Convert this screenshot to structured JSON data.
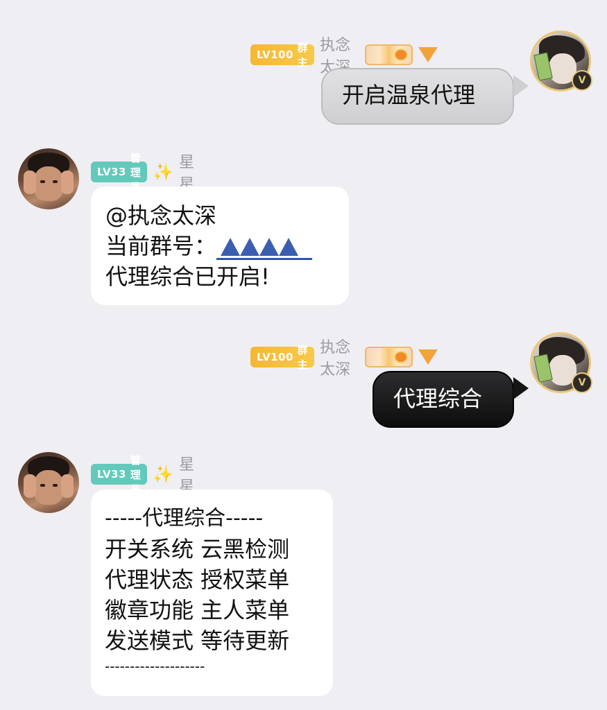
{
  "messages": [
    {
      "side": "right",
      "level": "LV100",
      "role": "群主",
      "name": "执念太深",
      "text": "开启温泉代理",
      "style": "grey"
    },
    {
      "side": "left",
      "level": "LV33",
      "role": "管理员",
      "sparkle": "✨",
      "name": "星星",
      "lines": [
        "@执念太深",
        "当前群号：",
        "代理综合已开启!"
      ],
      "style": "white"
    },
    {
      "side": "right",
      "level": "LV100",
      "role": "群主",
      "name": "执念太深",
      "text": "代理综合",
      "style": "black"
    },
    {
      "side": "left",
      "level": "LV33",
      "role": "管理员",
      "sparkle": "✨",
      "name": "星星",
      "lines": [
        "-----代理综合-----",
        "开关系统 云黑检测",
        "代理状态 授权菜单",
        "徽章功能 主人菜单",
        "发送模式 等待更新",
        "--------------------"
      ],
      "style": "white"
    }
  ],
  "badges": {
    "vip": "V"
  },
  "colors": {
    "background": "#efeef3",
    "gold_badge": "#f6b733",
    "teal_badge": "#63c9bb"
  }
}
